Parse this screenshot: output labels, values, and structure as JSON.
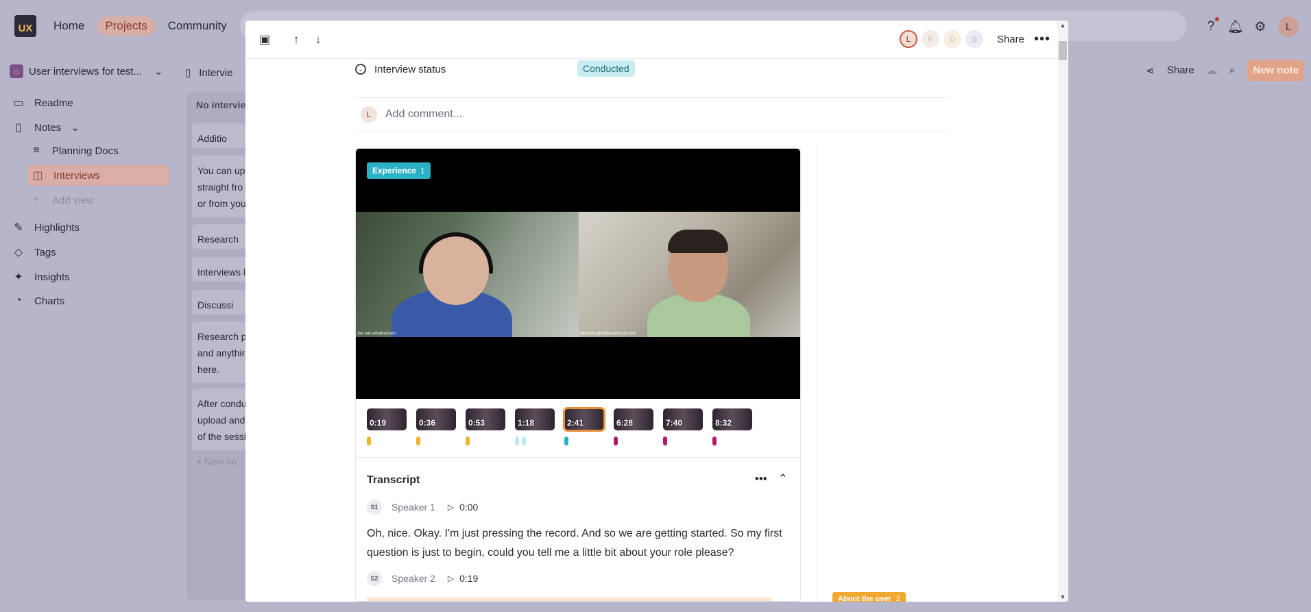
{
  "app": {
    "logo_text": "UX",
    "nav": [
      "Home",
      "Projects",
      "Community"
    ],
    "active_nav": "Projects"
  },
  "sidebar": {
    "project_name": "User interviews for test...",
    "items": [
      {
        "label": "Readme",
        "icon": "book-icon"
      },
      {
        "label": "Notes",
        "icon": "document-icon"
      },
      {
        "label": "Planning Docs",
        "icon": "list-icon"
      },
      {
        "label": "Interviews",
        "icon": "board-icon"
      },
      {
        "label": "Add view",
        "icon": "plus-icon"
      },
      {
        "label": "Highlights",
        "icon": "highlighter-icon"
      },
      {
        "label": "Tags",
        "icon": "tag-icon"
      },
      {
        "label": "Insights",
        "icon": "sparkle-icon"
      },
      {
        "label": "Charts",
        "icon": "pie-chart-icon"
      }
    ]
  },
  "board": {
    "header": "Intervie",
    "column_title": "No intervie",
    "cards": [
      "Additio",
      "You can upl\nstraight fro\nor from you",
      "Research",
      "Interviews l",
      "Discussi",
      "Research pl\nand anythir\nhere.",
      "After condu\nupload and\nof the sessi"
    ],
    "new_note": "New no"
  },
  "toolbar_right": {
    "share": "Share",
    "new_note": "New note"
  },
  "modal": {
    "collaborators": [
      "L",
      "K",
      "D",
      "S"
    ],
    "share": "Share",
    "status_label": "Interview status",
    "status_value": "Conducted",
    "comment_avatar": "L",
    "comment_placeholder": "Add comment...",
    "video": {
      "tag": "Experience",
      "tag_count": "1",
      "left_name": "Jan van Abrahamsen",
      "right_name": "laurentiu.ghe@smartlaser.com",
      "timestamps": [
        "0:19",
        "0:36",
        "0:53",
        "1:18",
        "2:41",
        "6:28",
        "7:40",
        "8:32"
      ],
      "selected_index": 4
    },
    "transcript": {
      "title": "Transcript",
      "speaker1_chip": "S1",
      "speaker1": "Speaker 1",
      "speaker1_time": "0:00",
      "speaker1_text": "Oh, nice. Okay. I'm just pressing the record. And so we are getting started. So my first question is just to begin, could you tell me a little bit about your role please?",
      "speaker2_chip": "S2",
      "speaker2": "Speaker 2",
      "speaker2_time": "0:19"
    },
    "side_tag": "About the user",
    "side_tag_count": "2"
  },
  "colors": {
    "accent": "#d8aea6",
    "experience_tag": "#2cb1c4",
    "about_user_tag": "#f0a831",
    "marker_yellow": "#f2b22a",
    "marker_cyan": "#2cb1c4",
    "marker_lightcyan": "#bfe8ef",
    "marker_magenta": "#b4176a"
  }
}
